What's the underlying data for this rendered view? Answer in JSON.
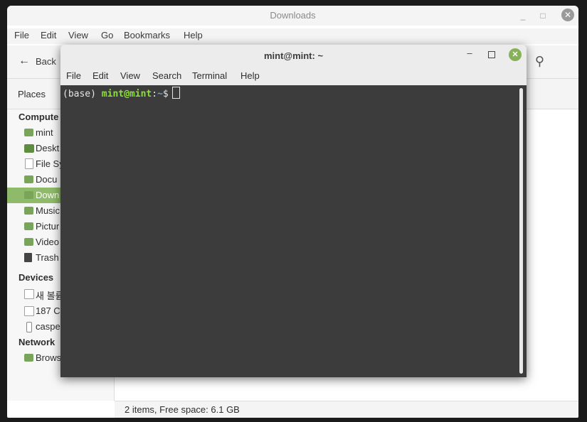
{
  "file_manager": {
    "title": "Downloads",
    "menu": [
      "File",
      "Edit",
      "View",
      "Go",
      "Bookmarks",
      "Help"
    ],
    "toolbar": {
      "back_label": "Back"
    },
    "places_label": "Places",
    "sidebar": {
      "computer_header": "Compute",
      "computer_items": [
        "mint",
        "Deskt",
        "File Sy",
        "Docu",
        "Down",
        "Music",
        "Pictur",
        "Video",
        "Trash"
      ],
      "devices_header": "Devices",
      "device_items": [
        "새 볼륨",
        "187 C",
        "caspe"
      ],
      "network_header": "Network",
      "network_items": [
        "Brows"
      ]
    },
    "status": "2 items, Free space: 6.1 GB"
  },
  "terminal": {
    "title": "mint@mint: ~",
    "menu": [
      "File",
      "Edit",
      "View",
      "Search",
      "Terminal",
      "Help"
    ],
    "prompt": {
      "env": "(base) ",
      "userhost": "mint@mint",
      "sep": ":",
      "path": "~",
      "symbol": "$"
    }
  },
  "colors": {
    "accent_green": "#8fba6a",
    "terminal_bg": "#3c3c3c",
    "prompt_green": "#8ae234",
    "prompt_blue": "#729fcf"
  }
}
